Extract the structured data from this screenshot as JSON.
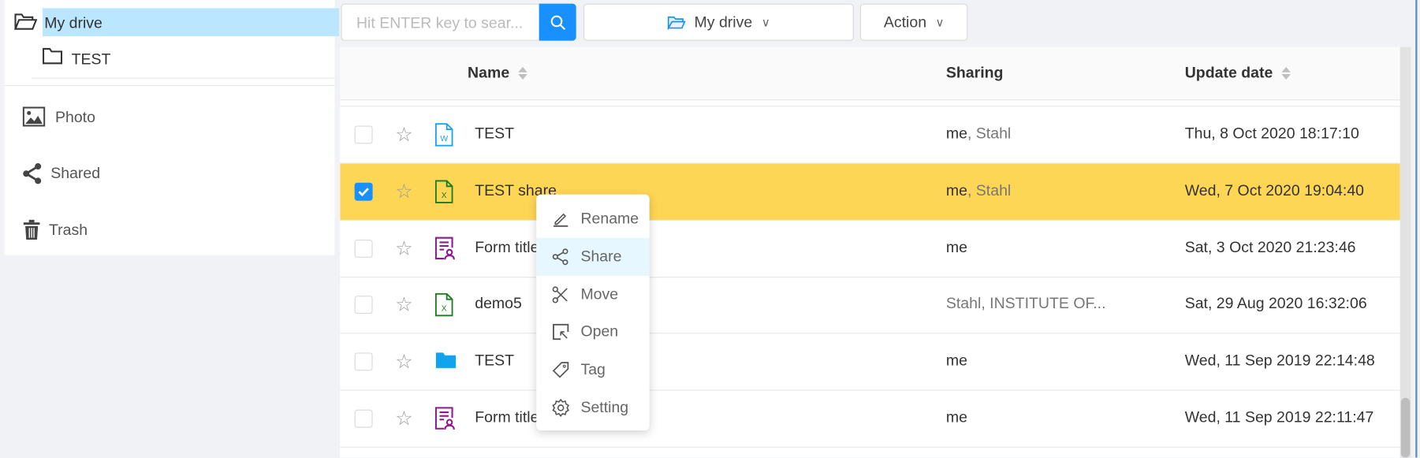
{
  "colors": {
    "primary": "#1890ff",
    "selected_row": "#fdd655",
    "tree_selected": "#bae7ff",
    "menu_hover": "#e6f7ff",
    "word": "#1aa3f0",
    "excel": "#1e7b1e",
    "form": "#8b1a8b",
    "folder": "#12a3f0"
  },
  "sidebar": {
    "tree": {
      "root": {
        "label": "My drive",
        "icon": "folder-open-icon"
      },
      "children": [
        {
          "label": "TEST",
          "icon": "folder-icon"
        }
      ]
    },
    "items": [
      {
        "label": "Photo",
        "icon": "image-icon"
      },
      {
        "label": "Shared",
        "icon": "share-icon"
      },
      {
        "label": "Trash",
        "icon": "trash-icon"
      }
    ]
  },
  "toolbar": {
    "search_placeholder": "Hit ENTER key to sear...",
    "search_icon": "search-icon",
    "location": "My drive",
    "action": "Action"
  },
  "table": {
    "columns": {
      "name": "Name",
      "sharing": "Sharing",
      "date": "Update date"
    },
    "rows": [
      {
        "name": "TEST",
        "type": "word",
        "owner": "me",
        "others": ", Stahl",
        "date": "Thu, 8 Oct 2020 18:17:10",
        "checked": false
      },
      {
        "name": "TEST share",
        "type": "excel",
        "owner": "me",
        "others": ", Stahl",
        "date": "Wed, 7 Oct 2020 19:04:40",
        "checked": true
      },
      {
        "name": "Form title",
        "type": "form",
        "owner": "me",
        "others": "",
        "date": "Sat, 3 Oct 2020 21:23:46",
        "checked": false
      },
      {
        "name": "demo5",
        "type": "excel",
        "owner": "",
        "others": "Stahl, INSTITUTE OF...",
        "date": "Sat, 29 Aug 2020 16:32:06",
        "checked": false
      },
      {
        "name": "TEST",
        "type": "folder",
        "owner": "me",
        "others": "",
        "date": "Wed, 11 Sep 2019 22:14:48",
        "checked": false
      },
      {
        "name": "Form title",
        "type": "form",
        "owner": "me",
        "others": "",
        "date": "Wed, 11 Sep 2019 22:11:47",
        "checked": false
      }
    ]
  },
  "context_menu": {
    "items": [
      {
        "label": "Rename",
        "icon": "edit-icon"
      },
      {
        "label": "Share",
        "icon": "share-icon",
        "hovered": true
      },
      {
        "label": "Move",
        "icon": "scissors-icon"
      },
      {
        "label": "Open",
        "icon": "open-icon"
      },
      {
        "label": "Tag",
        "icon": "tag-icon"
      },
      {
        "label": "Setting",
        "icon": "gear-icon"
      }
    ]
  }
}
